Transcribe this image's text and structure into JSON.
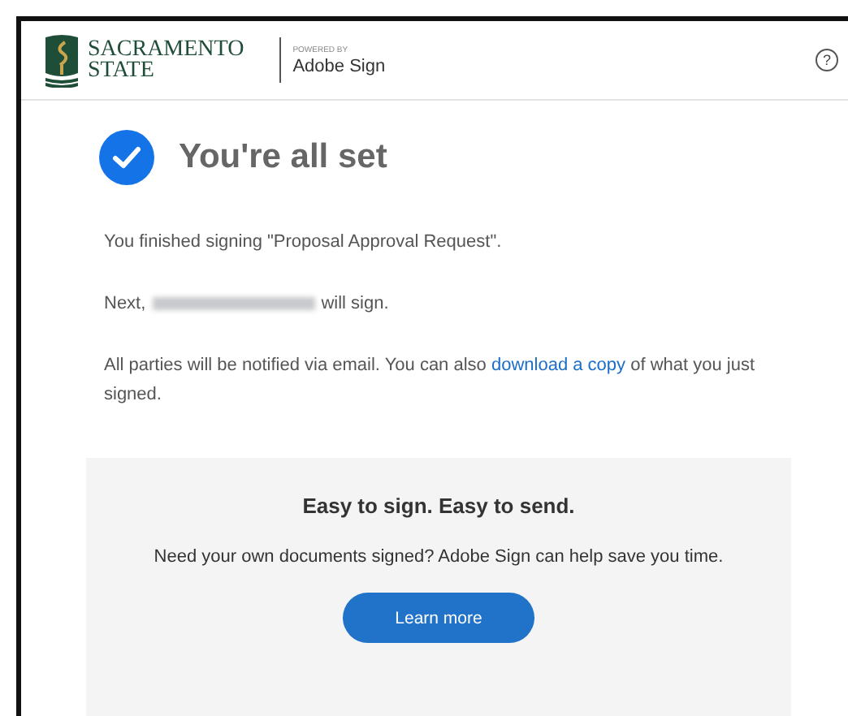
{
  "header": {
    "logo_line1": "SACRAMENTO",
    "logo_line2": "STATE",
    "powered_by": "POWERED BY",
    "product": "Adobe Sign",
    "help": "?"
  },
  "confirmation": {
    "title": "You're all set",
    "checked": true
  },
  "finished": "You finished signing \"Proposal Approval Request\".",
  "next": {
    "before": "Next,",
    "after": "will sign.",
    "recipient_redacted": true
  },
  "notice": {
    "before": "All parties will be notified via email. You can also",
    "link": "download a copy",
    "after": "of what you just signed."
  },
  "promo": {
    "title": "Easy to sign. Easy to send.",
    "text": "Need your own documents signed? Adobe Sign can help save you time.",
    "button": "Learn more"
  }
}
